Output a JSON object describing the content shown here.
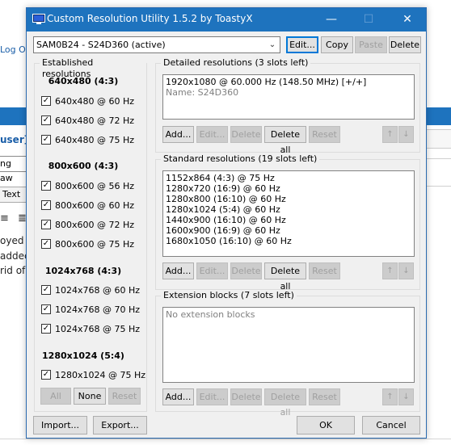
{
  "background": {
    "login_link": "Log Ou",
    "user_text": "user]",
    "input_text": "ng aw",
    "tab_text": "Text",
    "format_icons": [
      "≡",
      "≣"
    ],
    "body_lines": [
      "oyed",
      "addec",
      "rid of"
    ]
  },
  "dialog": {
    "title": "Custom Resolution Utility 1.5.2 by ToastyX",
    "window_controls": {
      "minimize": "—",
      "maximize": "☐",
      "close": "✕"
    },
    "monitor_select": {
      "value": "SAM0B24 - S24D360 (active)"
    },
    "top_buttons": {
      "edit": "Edit...",
      "copy": "Copy",
      "paste": "Paste",
      "delete": "Delete"
    },
    "established": {
      "title": "Established resolutions",
      "sections": [
        {
          "heading": "640x480 (4:3)",
          "items": [
            "640x480 @ 60 Hz",
            "640x480 @ 72 Hz",
            "640x480 @ 75 Hz"
          ]
        },
        {
          "heading": "800x600 (4:3)",
          "items": [
            "800x600 @ 56 Hz",
            "800x600 @ 60 Hz",
            "800x600 @ 72 Hz",
            "800x600 @ 75 Hz"
          ]
        },
        {
          "heading": "1024x768 (4:3)",
          "items": [
            "1024x768 @ 60 Hz",
            "1024x768 @ 70 Hz",
            "1024x768 @ 75 Hz"
          ]
        },
        {
          "heading": "1280x1024 (5:4)",
          "items": [
            "1280x1024 @ 75 Hz"
          ]
        }
      ],
      "buttons": {
        "all": "All",
        "none": "None",
        "reset": "Reset"
      }
    },
    "detailed": {
      "title": "Detailed resolutions (3 slots left)",
      "items": [
        "1920x1080 @ 60.000 Hz (148.50 MHz) [+/+]"
      ],
      "name_line": "Name: S24D360"
    },
    "standard": {
      "title": "Standard resolutions (19 slots left)",
      "items": [
        "1152x864 (4:3) @ 75 Hz",
        "1280x720 (16:9) @ 60 Hz",
        "1280x800 (16:10) @ 60 Hz",
        "1280x1024 (5:4) @ 60 Hz",
        "1440x900 (16:10) @ 60 Hz",
        "1600x900 (16:9) @ 60 Hz",
        "1680x1050 (16:10) @ 60 Hz"
      ]
    },
    "extension": {
      "title": "Extension blocks (7 slots left)",
      "placeholder": "No extension blocks"
    },
    "list_buttons": {
      "add": "Add...",
      "edit": "Edit...",
      "delete": "Delete",
      "delete_all": "Delete all",
      "reset": "Reset",
      "up": "↑",
      "down": "↓"
    },
    "footer": {
      "import": "Import...",
      "export": "Export...",
      "ok": "OK",
      "cancel": "Cancel"
    },
    "colors": {
      "titlebar": "#1e73be",
      "dialog_bg": "#f0f0f0",
      "focus": "#0078d7"
    }
  }
}
